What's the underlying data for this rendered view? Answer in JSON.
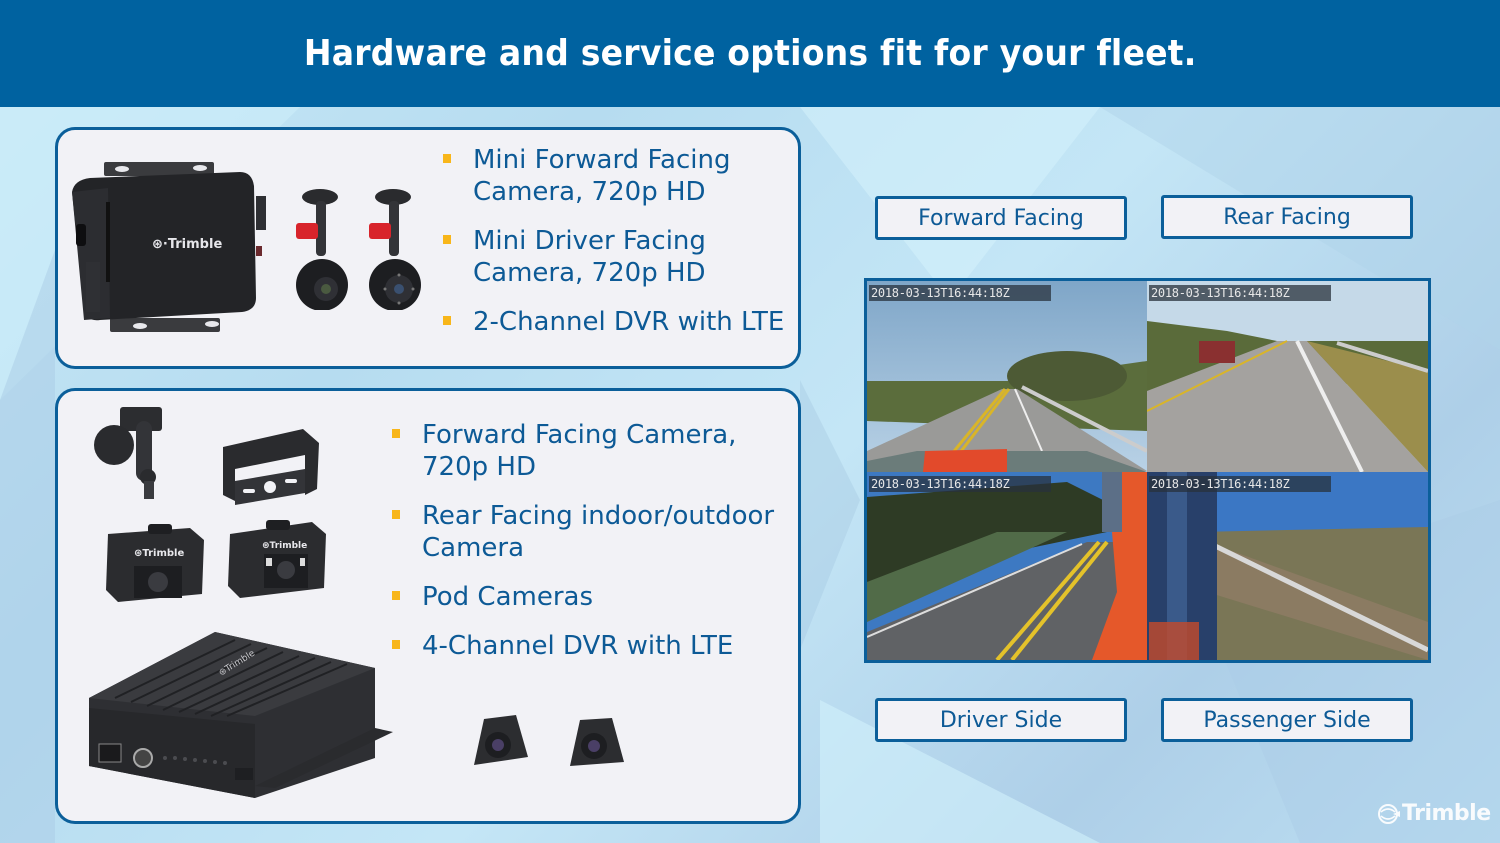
{
  "header": {
    "title": "Hardware and service options fit for your fleet."
  },
  "panel_top": {
    "bullets": [
      "Mini Forward Facing Camera, 720p HD",
      "Mini Driver Facing Camera, 720p HD",
      "2-Channel DVR with LTE"
    ],
    "device_brand": "Trimble"
  },
  "panel_bottom": {
    "bullets": [
      "Forward Facing Camera, 720p HD",
      "Rear Facing indoor/outdoor Camera",
      "Pod Cameras",
      "4-Channel DVR with LTE"
    ],
    "device_brand": "Trimble"
  },
  "camera_views": {
    "labels": {
      "forward": "Forward Facing",
      "rear": "Rear Facing",
      "driver": "Driver Side",
      "passenger": "Passenger Side"
    },
    "feeds": [
      {
        "name": "forward",
        "timestamp": "2018-03-13T16:44:18Z"
      },
      {
        "name": "rear",
        "timestamp": "2018-03-13T16:44:18Z"
      },
      {
        "name": "driver",
        "timestamp": "2018-03-13T16:44:18Z"
      },
      {
        "name": "passenger",
        "timestamp": "2018-03-13T16:44:18Z"
      }
    ]
  },
  "footer": {
    "logo_text": "Trimble"
  },
  "colors": {
    "header_bg": "#0062a0",
    "panel_border": "#0b5f9a",
    "text_blue": "#0d5a96",
    "bullet_gold": "#f8b61a",
    "panel_bg": "#f2f2f6"
  }
}
